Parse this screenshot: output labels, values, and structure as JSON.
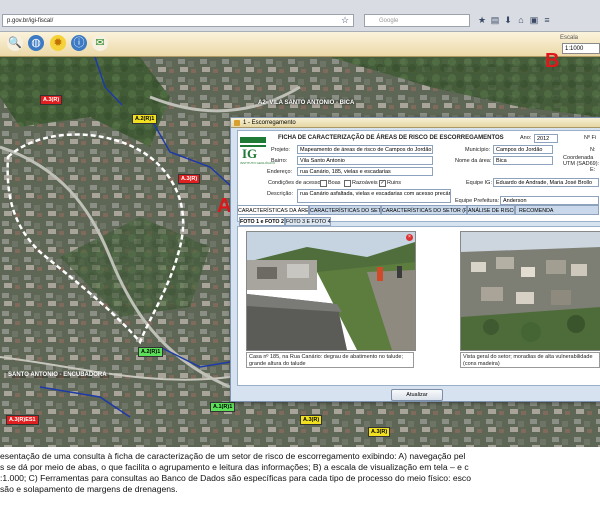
{
  "browser": {
    "url": "p.gov.br/igi-fiscal/",
    "search_placeholder": "Google",
    "icons": [
      "star-icon",
      "refresh-icon",
      "bookmark-icon",
      "download-icon",
      "home-icon",
      "menu-icon"
    ]
  },
  "toolbar": {
    "tools": [
      "zoom-icon",
      "globe-icon",
      "sun-icon",
      "info-globe-icon",
      "report-icon"
    ],
    "scale_label": "Escala",
    "scale_value": "1:1000"
  },
  "map": {
    "labels": [
      {
        "text": "A.3(R)",
        "color": "red"
      },
      {
        "text": "A.2(R)1",
        "color": "yellow"
      },
      {
        "text": "A2- VILA SANTO ANTONIO - BICA",
        "color": "none"
      },
      {
        "text": "A.3(R)",
        "color": "red"
      },
      {
        "text": "A.2(R)1",
        "color": "green"
      },
      {
        "text": "SANTO ANTONIO - ENCUBADORA",
        "color": "none"
      },
      {
        "text": "A.1(R)1",
        "color": "green"
      },
      {
        "text": "A.3(R)ES1",
        "color": "red"
      },
      {
        "text": "A.3(R)",
        "color": "yellow"
      },
      {
        "text": "A.3(R)",
        "color": "yellow"
      }
    ]
  },
  "annotations": {
    "a": "A",
    "b": "B"
  },
  "dialog": {
    "title": "1 - Escorregamento",
    "form_title": "FICHA DE CARACTERIZAÇÃO DE ÁREAS DE RISCO DE ESCORREGAMENTOS",
    "logo_text": "IG",
    "logo_sub": "INSTITUTO GEOLÓGICO",
    "fields": {
      "ano_label": "Ano:",
      "ano_value": "2012",
      "nf_label": "Nº Fi",
      "projeto_label": "Projeto:",
      "projeto_value": "Mapeamento de áreas de risco de Campos do Jordão",
      "municipio_label": "Município:",
      "municipio_value": "Campos do Jordão",
      "bairro_label": "Bairro:",
      "bairro_value": "Vila Santo Antonio",
      "nome_area_label": "Nome da área:",
      "nome_area_value": "Bica",
      "coord_label": "Coordenada UTM (SAD69):",
      "n_label": "N:",
      "e_label": "E:",
      "endereco_label": "Endereço:",
      "endereco_value": "rua Canário, 185, vielas e escadarias",
      "condicoes_label": "Condições de acesso:",
      "boas_label": "Boas",
      "razoaveis_label": "Razoáveis",
      "ruins_label": "Ruins",
      "equipe_ig_label": "Equipe IG:",
      "equipe_ig_value": "Eduardo de Andrade, Maria José Brollo",
      "descricao_label": "Descrição:",
      "descricao_value": "rua Canário asfaltada, vielas e escadarias com acesso precário",
      "equipe_pref_label": "Equipe Prefeitura:",
      "equipe_pref_value": "Anderson"
    },
    "tabs": [
      "CARACTERÍSTICAS DA ÁREA",
      "CARACTERÍSTICAS DO SETOR (PARTE 1)",
      "CARACTERÍSTICAS DO SETOR (PARTE 2)",
      "ANÁLISE DE RISCO",
      "RECOMENDA"
    ],
    "photo_tabs": [
      "FOTO 1 e FOTO 2",
      "FOTO 3 E FOTO 4"
    ],
    "photo1_caption": "Casa nº 185, na Rua Canário: degrau de abatimento no talude; grande altura do talude",
    "photo2_caption": "Vista geral do setor; moradias de alta vulnerabilidade (cons madeira)",
    "update_button": "Atualizar"
  },
  "figure_caption": {
    "line1": "esentação de uma consulta à ficha de caracterização de um setor de risco de escorregamento exibindo: A) navegação pel",
    "line2": "s se dá por meio de abas, o que facilita o agrupamento e leitura das informações; B) a escala de visualização em tela – e c",
    "line3": ":1.000; C) Ferramentas para consultas ao Banco de Dados são específicas para cada tipo de processo do meio físico: esco",
    "line4": "são e solapamento de margens de drenagens."
  }
}
